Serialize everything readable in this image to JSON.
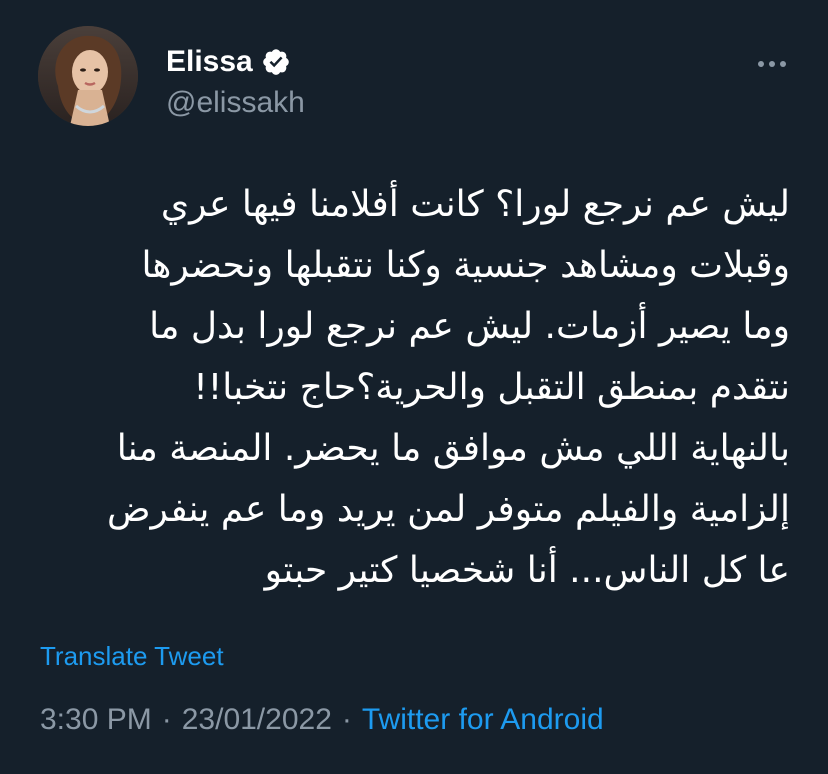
{
  "author": {
    "display_name": "Elissa",
    "handle": "@elissakh",
    "verified": true
  },
  "tweet": {
    "lines": [
      "ليش عم نرجع لورا؟ كانت أفلامنا فيها عري",
      "وقبلات ومشاهد جنسية وكنا نتقبلها ونحضرها",
      "وما يصير أزمات. ليش عم نرجع لورا بدل ما",
      "نتقدم بمنطق التقبل والحرية؟حاج نتخبا!!",
      "بالنهاية اللي مش موافق ما يحضر. المنصة منا",
      "إلزامية والفيلم متوفر لمن يريد وما عم ينفرض",
      "عا كل الناس... أنا شخصيا كتير حبتو"
    ],
    "translate_label": "Translate Tweet"
  },
  "meta": {
    "time": "3:30 PM",
    "separator": "·",
    "date": "23/01/2022",
    "source": "Twitter for Android"
  },
  "icons": {
    "verified": "verified-badge-icon",
    "more": "more-horizontal-icon"
  },
  "colors": {
    "background": "#15202b",
    "text_primary": "#ffffff",
    "text_secondary": "#8b98a5",
    "accent": "#1d9bf0"
  }
}
